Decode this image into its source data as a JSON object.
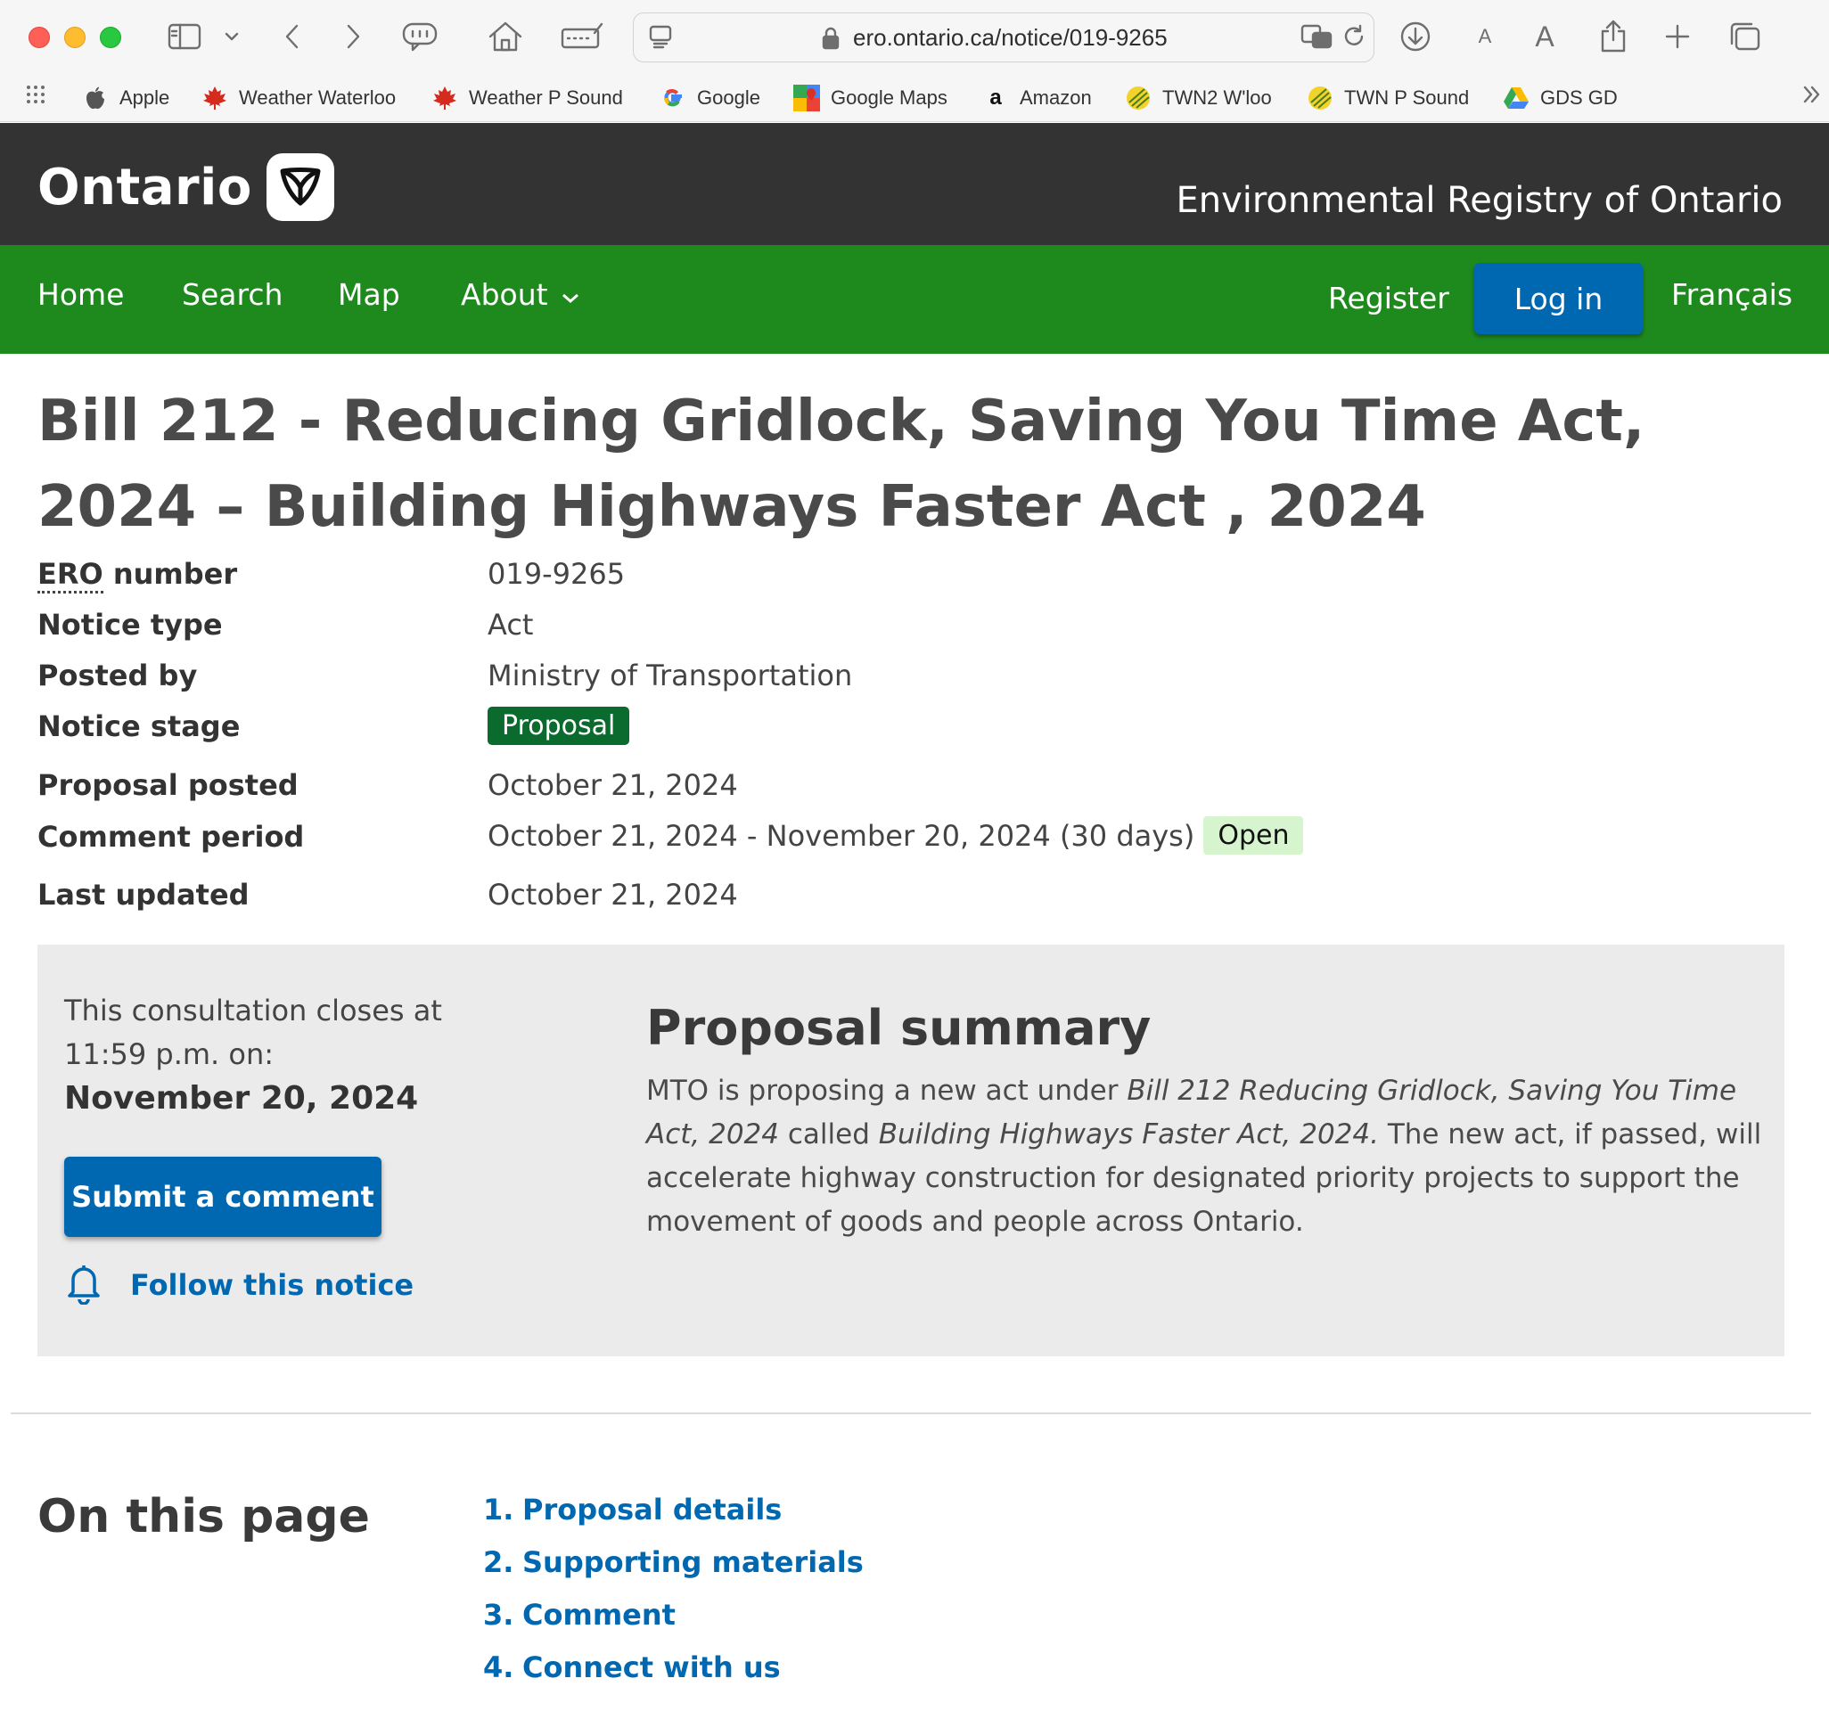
{
  "browser": {
    "url": "ero.ontario.ca/notice/019-9265",
    "bookmarks": [
      {
        "label": "Apple",
        "icon": "apple-icon"
      },
      {
        "label": "Weather Waterloo",
        "icon": "maple-leaf-icon"
      },
      {
        "label": "Weather P Sound",
        "icon": "maple-leaf-icon"
      },
      {
        "label": "Google",
        "icon": "google-icon"
      },
      {
        "label": "Google Maps",
        "icon": "google-maps-icon"
      },
      {
        "label": "Amazon",
        "icon": "amazon-icon"
      },
      {
        "label": "TWN2 W'loo",
        "icon": "twn-icon"
      },
      {
        "label": "TWN P Sound",
        "icon": "twn-icon"
      },
      {
        "label": "GDS GD",
        "icon": "google-drive-icon"
      }
    ],
    "font_small": "A",
    "font_large": "A"
  },
  "header": {
    "logo_text": "Ontario",
    "registry_title": "Environmental Registry of Ontario"
  },
  "nav": {
    "home": "Home",
    "search": "Search",
    "map": "Map",
    "about": "About",
    "register": "Register",
    "login": "Log in",
    "language": "Français"
  },
  "notice": {
    "title": "Bill 212 - Reducing Gridlock, Saving You Time Act, 2024 – Building Highways Faster Act , 2024",
    "fields": {
      "ero_label_abbr": "ERO",
      "ero_label_rest": " number",
      "ero_value": "019-9265",
      "type_label": "Notice type",
      "type_value": "Act",
      "posted_by_label": "Posted by",
      "posted_by_value": "Ministry of Transportation",
      "stage_label": "Notice stage",
      "stage_value": "Proposal",
      "proposal_posted_label": "Proposal posted",
      "proposal_posted_value": "October 21, 2024",
      "comment_period_label": "Comment period",
      "comment_period_value": "October 21, 2024 - November 20, 2024 (30 days)",
      "comment_status": "Open",
      "last_updated_label": "Last updated",
      "last_updated_value": "October 21, 2024"
    }
  },
  "consultation": {
    "closes_text": "This consultation closes at 11:59 p.m. on:",
    "closes_date": "November 20, 2024",
    "submit_label": "Submit a comment",
    "follow_label": "Follow this notice"
  },
  "summary": {
    "heading": "Proposal summary",
    "part1": "MTO is proposing a new act under ",
    "italic1": "Bill 212 Reducing Gridlock, Saving You Time Act, 2024",
    "part2": " called ",
    "italic2": "Building Highways Faster Act, 2024.",
    "part3": " The new act, if passed, will accelerate highway construction for designated priority projects to support the movement of goods and people across Ontario."
  },
  "on_this_page": {
    "heading": "On this page",
    "items": [
      {
        "num": "1.",
        "label": "Proposal details"
      },
      {
        "num": "2.",
        "label": "Supporting materials"
      },
      {
        "num": "3.",
        "label": "Comment"
      },
      {
        "num": "4.",
        "label": "Connect with us"
      }
    ]
  },
  "colors": {
    "header_bg": "#333333",
    "nav_green": "#1e8a1e",
    "link_blue": "#0067b1",
    "stage_badge": "#0b6a2d",
    "open_badge": "#d6f5cf",
    "panel_bg": "#ebebeb"
  }
}
